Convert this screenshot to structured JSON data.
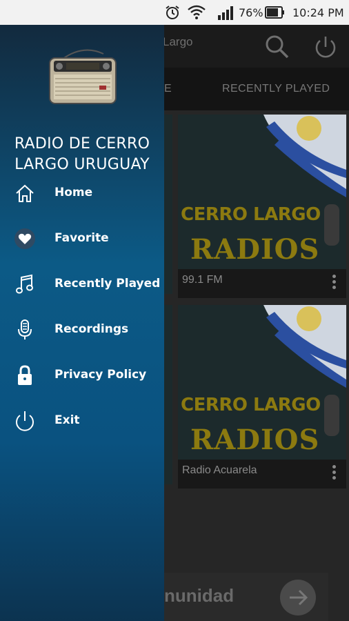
{
  "status_bar": {
    "battery": "76%",
    "time": "10:24 PM",
    "icons": [
      "alarm-icon",
      "wifi-icon",
      "signal-icon",
      "battery-icon"
    ]
  },
  "app": {
    "toolbar_title_partial": "Largo",
    "icons": [
      "search-icon",
      "power-icon"
    ],
    "tabs": [
      {
        "label": "E"
      },
      {
        "label": "RECENTLY PLAYED"
      }
    ],
    "cards": [
      {
        "logo_line1": "CERRO LARGO",
        "logo_line2": "RADIOS",
        "caption": "99.1 FM"
      },
      {
        "logo_line1": "CERRO LARGO",
        "logo_line2": "RADIOS",
        "caption": "Radio Acuarela"
      }
    ],
    "banner_text_partial": "nunidad"
  },
  "drawer": {
    "title_line1": "RADIO DE CERRO",
    "title_line2": "LARGO URUGUAY",
    "items": [
      {
        "label": "Home",
        "icon": "home-icon"
      },
      {
        "label": "Favorite",
        "icon": "heart-icon"
      },
      {
        "label": "Recently Played",
        "icon": "music-note-icon"
      },
      {
        "label": "Recordings",
        "icon": "microphone-icon"
      },
      {
        "label": "Privacy Policy",
        "icon": "lock-icon"
      },
      {
        "label": "Exit",
        "icon": "power-icon"
      }
    ]
  },
  "colors": {
    "drawer_gradient_top": "#122a3e",
    "drawer_gradient_mid": "#0c5a86",
    "logo_gold": "#8c7a10",
    "statusbar_bg": "#f2f2f2"
  }
}
